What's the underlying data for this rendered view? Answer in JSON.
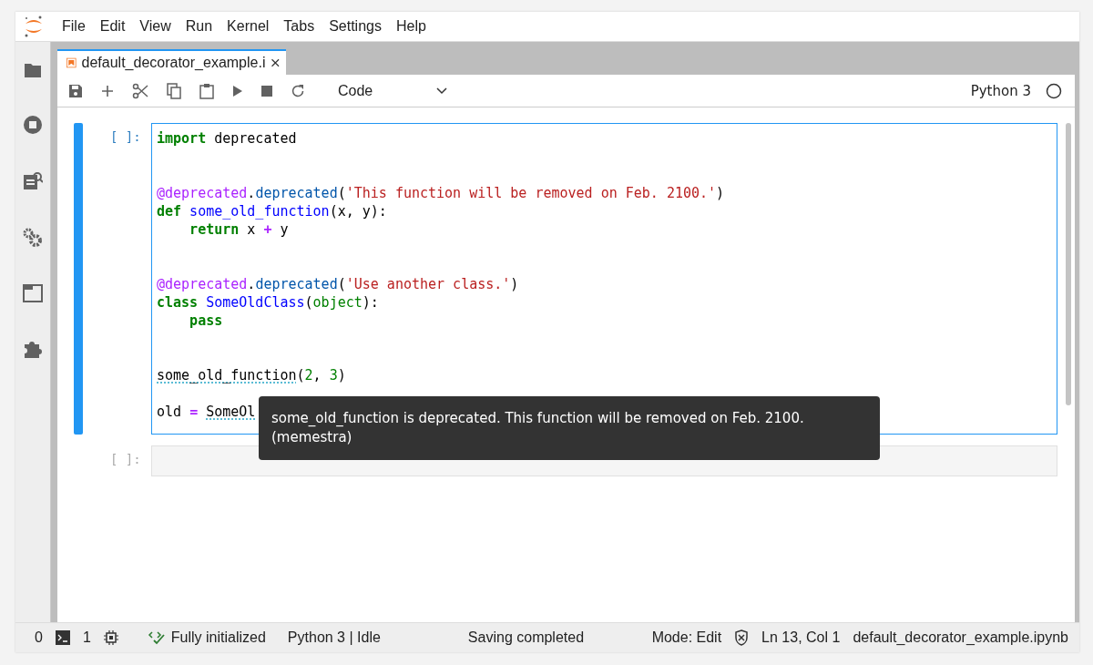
{
  "menu": [
    "File",
    "Edit",
    "View",
    "Run",
    "Kernel",
    "Tabs",
    "Settings",
    "Help"
  ],
  "tabs": [
    {
      "label": "default_decorator_example.i",
      "selected": true
    }
  ],
  "toolbar": {
    "cell_type": "Code",
    "kernel": "Python 3",
    "kernel_busy": false
  },
  "cells": [
    {
      "prompt": "[ ]:",
      "active": true,
      "lines": [
        {
          "kind": "code",
          "tokens": [
            {
              "text": "import",
              "kind": "keyword"
            },
            {
              "text": " deprecated",
              "kind": "plain"
            }
          ]
        },
        {
          "kind": "blank"
        },
        {
          "kind": "blank"
        },
        {
          "kind": "code",
          "tokens": [
            {
              "text": "@deprecated",
              "kind": "decorator"
            },
            {
              "text": ".",
              "kind": "plain"
            },
            {
              "text": "deprecated",
              "kind": "attr"
            },
            {
              "text": "(",
              "kind": "plain"
            },
            {
              "text": "'This function will be removed on Feb. 2100.'",
              "kind": "string"
            },
            {
              "text": ")",
              "kind": "plain"
            }
          ]
        },
        {
          "kind": "code",
          "tokens": [
            {
              "text": "def",
              "kind": "keyword"
            },
            {
              "text": " some_old_function",
              "kind": "name"
            },
            {
              "text": "(x, y):",
              "kind": "plain"
            }
          ]
        },
        {
          "kind": "code",
          "tokens": [
            {
              "text": "    return",
              "kind": "keyword"
            },
            {
              "text": " x ",
              "kind": "plain"
            },
            {
              "text": "+",
              "kind": "operator"
            },
            {
              "text": " y",
              "kind": "plain"
            }
          ]
        },
        {
          "kind": "blank"
        },
        {
          "kind": "blank"
        },
        {
          "kind": "code",
          "tokens": [
            {
              "text": "@deprecated",
              "kind": "decorator"
            },
            {
              "text": ".",
              "kind": "plain"
            },
            {
              "text": "deprecated",
              "kind": "attr"
            },
            {
              "text": "(",
              "kind": "plain"
            },
            {
              "text": "'Use another class.'",
              "kind": "string"
            },
            {
              "text": ")",
              "kind": "plain"
            }
          ]
        },
        {
          "kind": "code",
          "tokens": [
            {
              "text": "class",
              "kind": "keyword"
            },
            {
              "text": " SomeOldClass",
              "kind": "name"
            },
            {
              "text": "(",
              "kind": "plain"
            },
            {
              "text": "object",
              "kind": "builtin"
            },
            {
              "text": "):",
              "kind": "plain"
            }
          ]
        },
        {
          "kind": "code",
          "tokens": [
            {
              "text": "    pass",
              "kind": "keyword"
            }
          ]
        },
        {
          "kind": "blank"
        },
        {
          "kind": "blank"
        },
        {
          "kind": "code",
          "tokens": [
            {
              "text": "some_old_function",
              "kind": "deprecated"
            },
            {
              "text": "(",
              "kind": "plain"
            },
            {
              "text": "2",
              "kind": "number"
            },
            {
              "text": ", ",
              "kind": "plain"
            },
            {
              "text": "3",
              "kind": "number"
            },
            {
              "text": ")",
              "kind": "plain"
            }
          ]
        },
        {
          "kind": "blank"
        },
        {
          "kind": "code",
          "tokens": [
            {
              "text": "old ",
              "kind": "plain"
            },
            {
              "text": "= ",
              "kind": "operator"
            },
            {
              "text": "SomeOl",
              "kind": "deprecated"
            }
          ]
        }
      ]
    },
    {
      "prompt": "[ ]:",
      "active": false
    }
  ],
  "tooltip": {
    "lines": [
      "some_old_function is deprecated. This function will be removed on Feb. 2100.",
      "(memestra)"
    ]
  },
  "status_bar": {
    "terminals": "0",
    "kernels": "1",
    "lsp": "Fully initialized",
    "kernel_status": "Python 3 | Idle",
    "save_status": "Saving completed",
    "mode": "Mode: Edit",
    "cursor": "Ln 13, Col 1",
    "file": "default_decorator_example.ipynb"
  }
}
